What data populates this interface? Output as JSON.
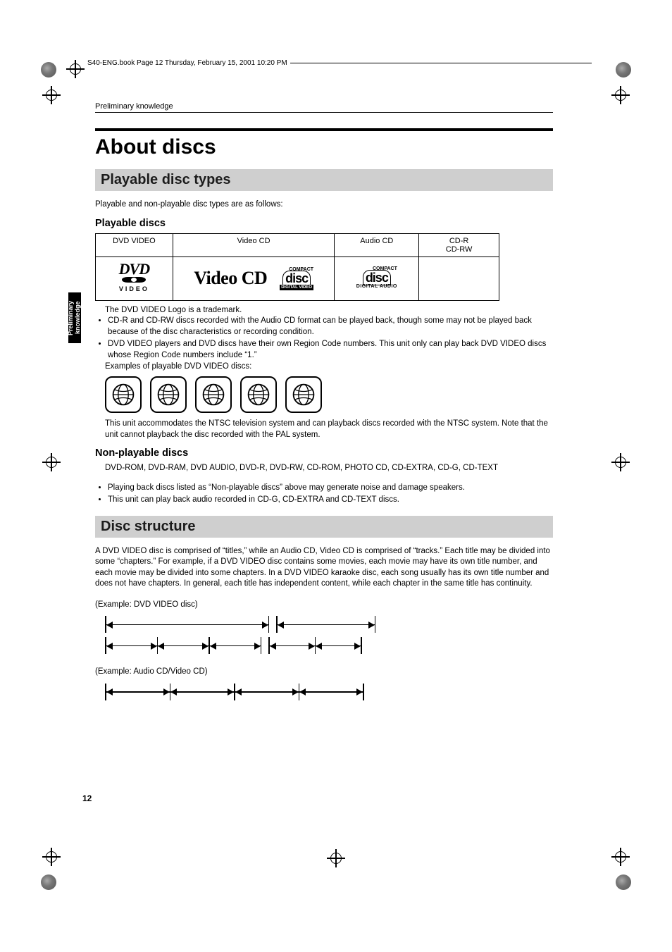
{
  "book_header": "S40-ENG.book  Page 12  Thursday, February 15, 2001  10:20 PM",
  "running_head": "Preliminary knowledge",
  "side_tab": "Preliminary knowledge",
  "title": "About discs",
  "section1": {
    "heading": "Playable disc types",
    "intro": "Playable and non-playable disc types are as follows:",
    "playable_heading": "Playable discs",
    "table_headers": [
      "DVD VIDEO",
      "Video CD",
      "Audio CD",
      "CD-R\nCD-RW"
    ],
    "logos": {
      "dvd_top": "DVD",
      "dvd_bottom": "VIDEO",
      "videocd": "Video CD",
      "compact_label": "COMPACT",
      "compact_sub_dv": "DIGITAL VIDEO",
      "compact_sub_da": "DIGITAL AUDIO"
    },
    "trademark_note": "The DVD VIDEO Logo is a trademark.",
    "bullets1": [
      "CD-R and CD-RW discs recorded with the Audio CD format can be played back, though some may not be played back because of the disc characteristics or recording condition.",
      "DVD VIDEO players and DVD discs have their own Region Code numbers. This unit only can play back DVD VIDEO discs whose Region Code numbers include “1.”"
    ],
    "examples_label": "Examples of playable DVD VIDEO discs:",
    "ntsc_note": "This unit accommodates the NTSC television system and can playback discs recorded with the NTSC system. Note that the unit cannot playback the disc recorded with the PAL system.",
    "nonplayable_heading": "Non-playable discs",
    "nonplayable_list": "DVD-ROM, DVD-RAM, DVD AUDIO, DVD-R, DVD-RW, CD-ROM, PHOTO CD, CD-EXTRA, CD-G, CD-TEXT",
    "bullets2": [
      "Playing back discs listed as “Non-playable discs” above may generate noise and damage speakers.",
      "This unit can play back audio recorded in CD-G, CD-EXTRA and CD-TEXT discs."
    ]
  },
  "section2": {
    "heading": "Disc structure",
    "paragraph": "A DVD VIDEO disc is comprised of “titles,” while an Audio CD, Video CD is comprised of “tracks.” Each title may be divided into some “chapters.” For example, if a DVD VIDEO disc contains some movies, each movie may have its own title number, and each movie may be divided into some chapters. In a DVD VIDEO karaoke disc, each song usually has its own title number and does not have chapters. In general, each title has independent content, while each chapter in the same title has continuity.",
    "example1": "(Example: DVD VIDEO disc)",
    "example2": "(Example: Audio CD/Video CD)"
  },
  "page_number": "12"
}
